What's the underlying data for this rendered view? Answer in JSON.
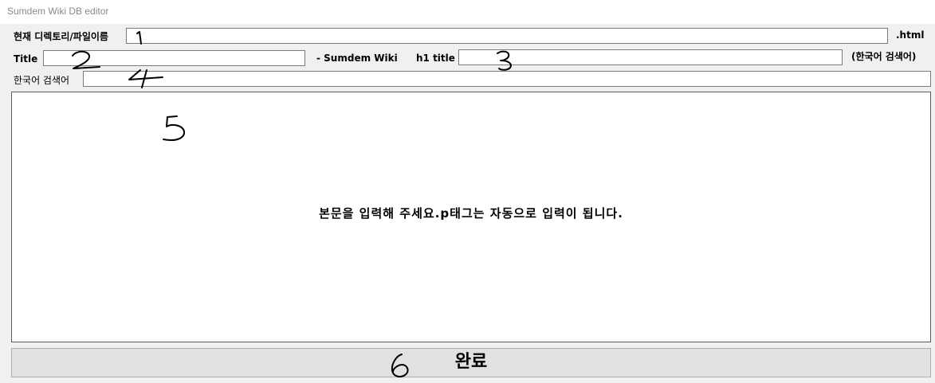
{
  "window": {
    "title": "Sumdem Wiki DB editor"
  },
  "row1": {
    "label": "현재 디렉토리/파일이름",
    "value": "",
    "suffix": ".html"
  },
  "row2": {
    "title_label": "Title",
    "title_value": "",
    "separator": "- Sumdem Wiki",
    "h1_label": "h1 title",
    "h1_value": "",
    "hint": "(한국어 검색어)"
  },
  "row3": {
    "label": "한국어 검색어",
    "value": ""
  },
  "editor": {
    "placeholder": "본문을 입력해 주세요.p태그는 자동으로 입력이 됩니다."
  },
  "done_button": {
    "label": "완료"
  },
  "annotations": [
    "1",
    "2",
    "3",
    "4",
    "5",
    "6"
  ]
}
